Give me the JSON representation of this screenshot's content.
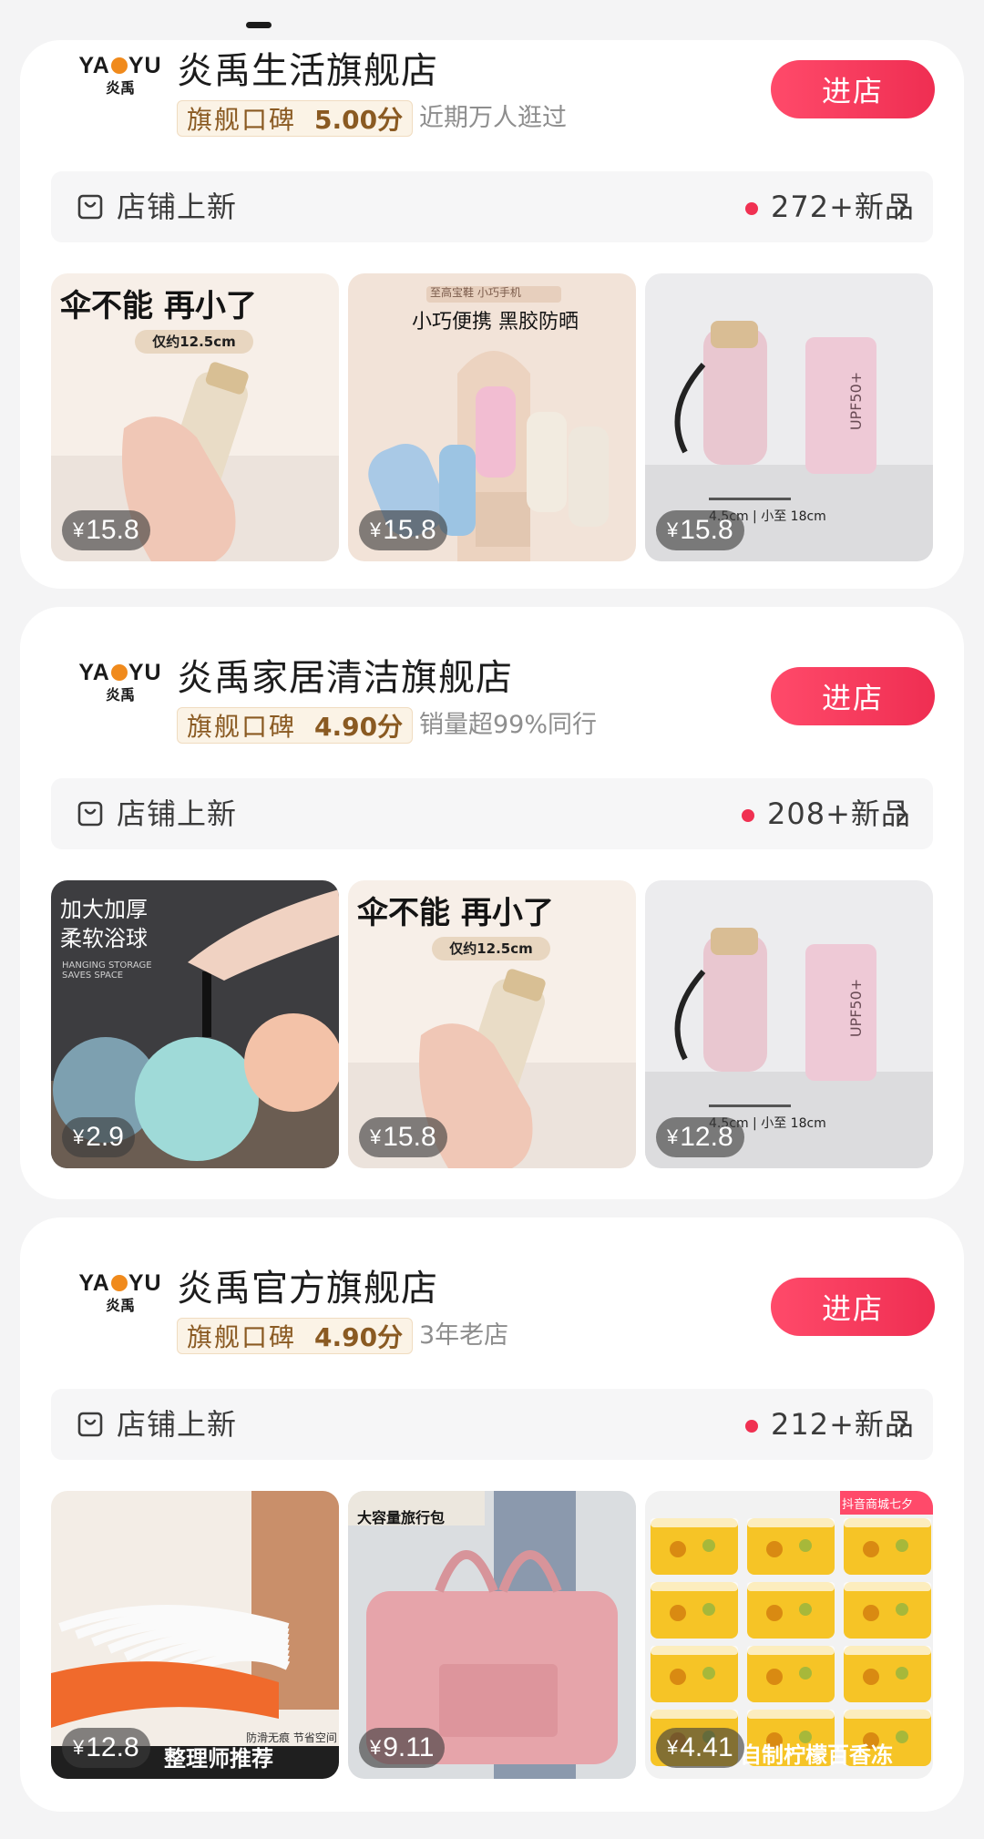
{
  "stores": [
    {
      "logo_en": "YAMYU",
      "logo_cn": "炎禹",
      "name": "炎禹生活旗舰店",
      "badge_label": "旗舰口碑",
      "score": "5.00分",
      "note": "近期万人逛过",
      "enter_label": "进店",
      "new_label": "店铺上新",
      "new_count": "272+新品",
      "products": [
        {
          "price": "15.8",
          "caption": "伞不能  再小了",
          "tag": "仅约12.5cm",
          "kind": "umbrella-hand"
        },
        {
          "price": "15.8",
          "caption": "小巧便携 黑胶防晒",
          "tag": "至高宝鞋 小巧手机",
          "kind": "umbrella-group"
        },
        {
          "price": "15.8",
          "caption": "UPF50+",
          "tag": "4.5cm | 小至 18cm",
          "kind": "umbrella-pink"
        }
      ]
    },
    {
      "logo_en": "YAMYU",
      "logo_cn": "炎禹",
      "name": "炎禹家居清洁旗舰店",
      "badge_label": "旗舰口碑",
      "score": "4.90分",
      "note": "销量超99%同行",
      "enter_label": "进店",
      "new_label": "店铺上新",
      "new_count": "208+新品",
      "products": [
        {
          "price": "2.9",
          "caption": "加大加厚\n柔软浴球",
          "tag": "HANGING STORAGE SAVES SPACE",
          "kind": "bath-ball"
        },
        {
          "price": "15.8",
          "caption": "伞不能  再小了",
          "tag": "仅约12.5cm",
          "kind": "umbrella-hand"
        },
        {
          "price": "12.8",
          "caption": "UPF50+",
          "tag": "4.5cm | 小至 18cm",
          "kind": "umbrella-pink"
        }
      ]
    },
    {
      "logo_en": "YAMYU",
      "logo_cn": "炎禹",
      "name": "炎禹官方旗舰店",
      "badge_label": "旗舰口碑",
      "score": "4.90分",
      "note": "3年老店",
      "enter_label": "进店",
      "new_label": "店铺上新",
      "new_count": "212+新品",
      "products": [
        {
          "price": "12.8",
          "caption": "整理师推荐",
          "tag": "防滑无痕 节省空间",
          "kind": "hangers"
        },
        {
          "price": "9.11",
          "caption": "大容量旅行包",
          "tag": "",
          "kind": "travel-bag"
        },
        {
          "price": "4.41",
          "caption": "自制柠檬百香冻",
          "tag": "抖音商城七夕",
          "kind": "lemon-cups"
        }
      ]
    }
  ],
  "colors": {
    "accent": "#f03152",
    "badge_text": "#8a5a22",
    "badge_bg": "#fbf3e6"
  },
  "icons": {
    "new_bar": "shopping-bag-icon",
    "more": "chevron-right-icon"
  }
}
